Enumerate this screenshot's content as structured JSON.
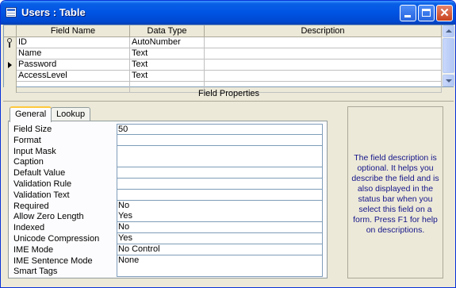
{
  "window": {
    "title": "Users : Table"
  },
  "grid": {
    "columns": [
      "Field Name",
      "Data Type",
      "Description"
    ],
    "rows": [
      {
        "field_name": "ID",
        "data_type": "AutoNumber",
        "description": "",
        "primary_key": true,
        "current": false
      },
      {
        "field_name": "Name",
        "data_type": "Text",
        "description": "",
        "primary_key": false,
        "current": false
      },
      {
        "field_name": "Password",
        "data_type": "Text",
        "description": "",
        "primary_key": false,
        "current": true
      },
      {
        "field_name": "AccessLevel",
        "data_type": "Text",
        "description": "",
        "primary_key": false,
        "current": false
      },
      {
        "field_name": "",
        "data_type": "",
        "description": "",
        "primary_key": false,
        "current": false
      }
    ]
  },
  "field_properties": {
    "title": "Field Properties",
    "tabs": [
      "General",
      "Lookup"
    ],
    "active_tab": "General",
    "properties": [
      {
        "label": "Field Size",
        "value": "50"
      },
      {
        "label": "Format",
        "value": ""
      },
      {
        "label": "Input Mask",
        "value": ""
      },
      {
        "label": "Caption",
        "value": ""
      },
      {
        "label": "Default Value",
        "value": ""
      },
      {
        "label": "Validation Rule",
        "value": ""
      },
      {
        "label": "Validation Text",
        "value": ""
      },
      {
        "label": "Required",
        "value": "No"
      },
      {
        "label": "Allow Zero Length",
        "value": "Yes"
      },
      {
        "label": "Indexed",
        "value": "No"
      },
      {
        "label": "Unicode Compression",
        "value": "Yes"
      },
      {
        "label": "IME Mode",
        "value": "No Control"
      },
      {
        "label": "IME Sentence Mode",
        "value": "None"
      },
      {
        "label": "Smart Tags",
        "value": ""
      }
    ],
    "help_text": "The field description is optional.  It helps you describe the field and is also displayed in the status bar when you select this field on a form.  Press F1 for help on descriptions."
  },
  "colors": {
    "title_bar": "#0054e3",
    "help_text": "#15158a",
    "tab_highlight": "#ffc83c"
  }
}
